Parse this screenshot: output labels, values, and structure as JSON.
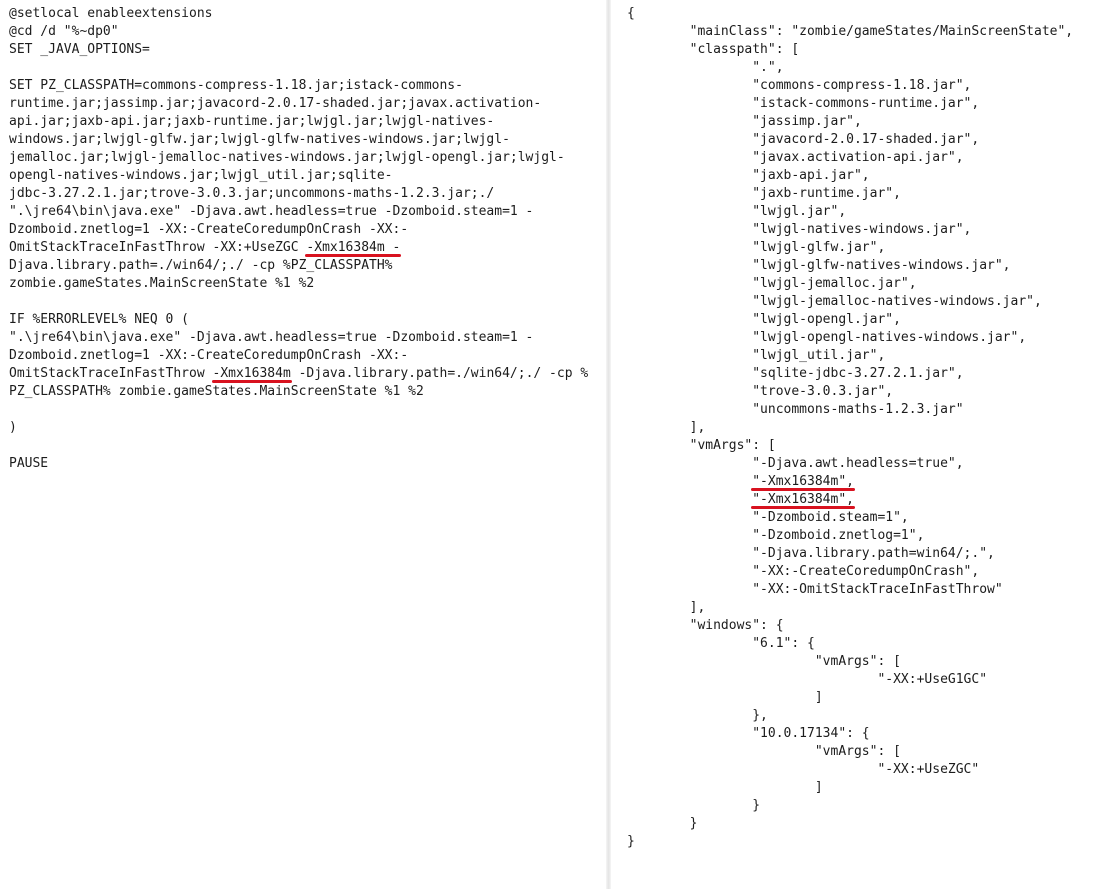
{
  "left_pane": {
    "lines": [
      "@setlocal enableextensions",
      "@cd /d \"%~dp0\"",
      "SET _JAVA_OPTIONS=",
      "",
      "SET PZ_CLASSPATH=commons-compress-1.18.jar;istack-commons-",
      "runtime.jar;jassimp.jar;javacord-2.0.17-shaded.jar;javax.activation-",
      "api.jar;jaxb-api.jar;jaxb-runtime.jar;lwjgl.jar;lwjgl-natives-",
      "windows.jar;lwjgl-glfw.jar;lwjgl-glfw-natives-windows.jar;lwjgl-",
      "jemalloc.jar;lwjgl-jemalloc-natives-windows.jar;lwjgl-opengl.jar;lwjgl-",
      "opengl-natives-windows.jar;lwjgl_util.jar;sqlite-",
      "jdbc-3.27.2.1.jar;trove-3.0.3.jar;uncommons-maths-1.2.3.jar;./",
      "\".\\jre64\\bin\\java.exe\" -Djava.awt.headless=true -Dzomboid.steam=1 -",
      "Dzomboid.znetlog=1 -XX:-CreateCoredumpOnCrash -XX:-",
      [
        "OmitStackTraceInFastThrow -XX:+UseZGC ",
        {
          "mark": "-Xmx16384m -"
        },
        ""
      ],
      "Djava.library.path=./win64/;./ -cp %PZ_CLASSPATH%",
      "zombie.gameStates.MainScreenState %1 %2",
      "",
      "IF %ERRORLEVEL% NEQ 0 (",
      "\".\\jre64\\bin\\java.exe\" -Djava.awt.headless=true -Dzomboid.steam=1 -",
      "Dzomboid.znetlog=1 -XX:-CreateCoredumpOnCrash -XX:-",
      [
        "OmitStackTraceInFastThrow ",
        {
          "mark": "-Xmx16384m"
        },
        " -Djava.library.path=./win64/;./ -cp %"
      ],
      "PZ_CLASSPATH% zombie.gameStates.MainScreenState %1 %2",
      "",
      ")",
      "",
      "PAUSE"
    ]
  },
  "right_pane": {
    "lines": [
      "{",
      "        \"mainClass\": \"zombie/gameStates/MainScreenState\",",
      "        \"classpath\": [",
      "                \".\",",
      "                \"commons-compress-1.18.jar\",",
      "                \"istack-commons-runtime.jar\",",
      "                \"jassimp.jar\",",
      "                \"javacord-2.0.17-shaded.jar\",",
      "                \"javax.activation-api.jar\",",
      "                \"jaxb-api.jar\",",
      "                \"jaxb-runtime.jar\",",
      "                \"lwjgl.jar\",",
      "                \"lwjgl-natives-windows.jar\",",
      "                \"lwjgl-glfw.jar\",",
      "                \"lwjgl-glfw-natives-windows.jar\",",
      "                \"lwjgl-jemalloc.jar\",",
      "                \"lwjgl-jemalloc-natives-windows.jar\",",
      "                \"lwjgl-opengl.jar\",",
      "                \"lwjgl-opengl-natives-windows.jar\",",
      "                \"lwjgl_util.jar\",",
      "                \"sqlite-jdbc-3.27.2.1.jar\",",
      "                \"trove-3.0.3.jar\",",
      "                \"uncommons-maths-1.2.3.jar\"",
      "        ],",
      "        \"vmArgs\": [",
      "                \"-Djava.awt.headless=true\",",
      [
        "                ",
        {
          "mark": "\"-Xmx16384m\","
        },
        ""
      ],
      [
        "                ",
        {
          "mark": "\"-Xmx16384m\","
        },
        ""
      ],
      "                \"-Dzomboid.steam=1\",",
      "                \"-Dzomboid.znetlog=1\",",
      "                \"-Djava.library.path=win64/;.\",",
      "                \"-XX:-CreateCoredumpOnCrash\",",
      "                \"-XX:-OmitStackTraceInFastThrow\"",
      "        ],",
      "        \"windows\": {",
      "                \"6.1\": {",
      "                        \"vmArgs\": [",
      "                                \"-XX:+UseG1GC\"",
      "                        ]",
      "                },",
      "                \"10.0.17134\": {",
      "                        \"vmArgs\": [",
      "                                \"-XX:+UseZGC\"",
      "                        ]",
      "                }",
      "        }",
      "}"
    ]
  },
  "colors": {
    "text": "#1c1c1c",
    "underline": "#d8121f",
    "background": "#ffffff"
  }
}
